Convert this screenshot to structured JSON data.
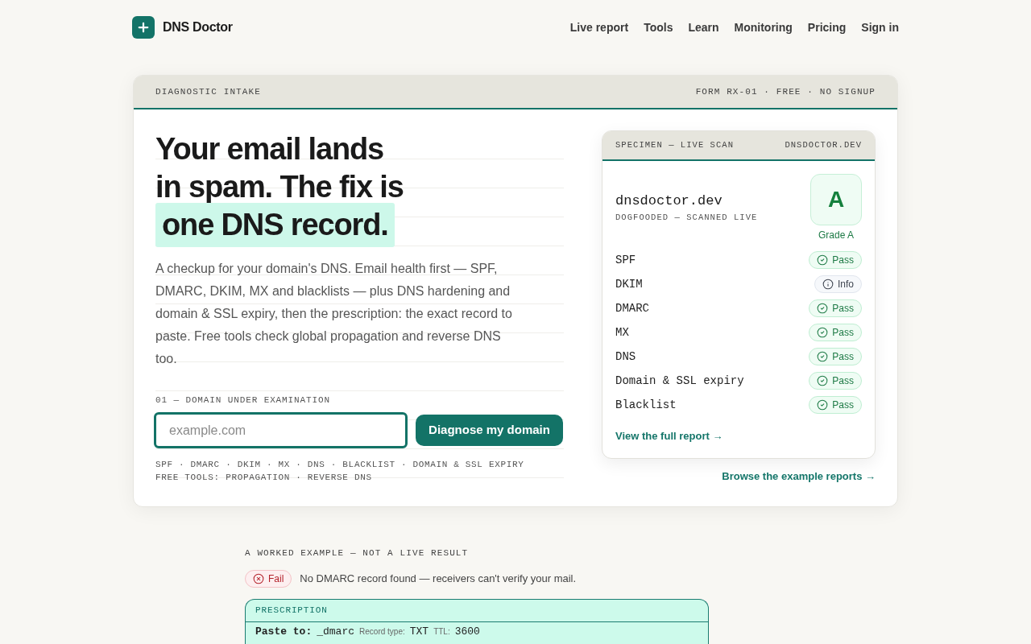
{
  "nav": {
    "brand": "DNS Doctor",
    "links": [
      "Live report",
      "Tools",
      "Learn",
      "Monitoring",
      "Pricing",
      "Sign in"
    ]
  },
  "intake": {
    "header_left": "DIAGNOSTIC INTAKE",
    "header_right": "FORM RX-01 · FREE · NO SIGNUP",
    "headline_lines": [
      "Your email lands",
      "in spam. The fix is"
    ],
    "headline_highlight": "one DNS record.",
    "description": "A checkup for your domain's DNS. Email health first — SPF, DMARC, DKIM, MX and blacklists — plus DNS hardening and domain & SSL expiry, then the prescription: the exact record to paste. Free tools check global propagation and reverse DNS too.",
    "field_label": "01 — DOMAIN UNDER EXAMINATION",
    "domain_field": {
      "placeholder": "example.com"
    },
    "submit_button": "Diagnose my domain",
    "check_list": "SPF · DMARC · DKIM · MX · DNS · BLACKLIST · DOMAIN & SSL EXPIRY",
    "free_tools": "FREE TOOLS: PROPAGATION · REVERSE DNS"
  },
  "specimen": {
    "header_left": "SPECIMEN — LIVE SCAN",
    "header_right": "DNSDOCTOR.DEV",
    "domain": "dnsdoctor.dev",
    "subtitle": "DOGFOODED — SCANNED LIVE",
    "grade": "A",
    "grade_label": "Grade A",
    "checks": [
      {
        "name": "SPF",
        "kind": "pass",
        "label": "Pass"
      },
      {
        "name": "DKIM",
        "kind": "info",
        "label": "Info"
      },
      {
        "name": "DMARC",
        "kind": "pass",
        "label": "Pass"
      },
      {
        "name": "MX",
        "kind": "pass",
        "label": "Pass"
      },
      {
        "name": "DNS",
        "kind": "pass",
        "label": "Pass"
      },
      {
        "name": "Domain & SSL expiry",
        "kind": "pass",
        "label": "Pass"
      },
      {
        "name": "Blacklist",
        "kind": "pass",
        "label": "Pass"
      }
    ],
    "report_link": "View the full report →"
  },
  "browse_link": "Browse the example reports →",
  "example": {
    "label": "A WORKED EXAMPLE — NOT A LIVE RESULT",
    "result": {
      "kind": "fail",
      "label": "Fail"
    },
    "message": "No DMARC record found — receivers can't verify your mail.",
    "prescription": {
      "title": "PRESCRIPTION",
      "fields": [
        {
          "label": "Paste to:",
          "value": "_dmarc"
        },
        {
          "label": "Record type:",
          "value": "TXT"
        },
        {
          "label": "TTL:",
          "value": "3600"
        }
      ]
    }
  }
}
